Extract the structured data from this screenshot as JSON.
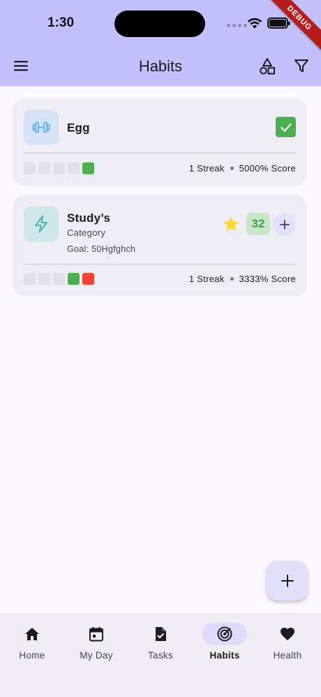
{
  "status_bar": {
    "time": "1:30",
    "debug_label": "DEBUG"
  },
  "app_bar": {
    "title": "Habits"
  },
  "habits": [
    {
      "name": "Egg",
      "icon": "dumbbell-icon",
      "icon_color": "#64b5f6",
      "completed": true,
      "streak_text": "1 Streak",
      "score_text": "5000% Score"
    },
    {
      "name": "Study’s",
      "category": "Category",
      "goal": "Goal: 50Hgfghch",
      "icon": "bolt-icon",
      "icon_color": "#4db6ac",
      "count": "32",
      "streak_text": "1 Streak",
      "score_text": "3333% Score"
    }
  ],
  "fab": {
    "icon": "plus-icon"
  },
  "bottom_nav": {
    "items": [
      {
        "label": "Home",
        "icon": "home-icon"
      },
      {
        "label": "My Day",
        "icon": "calendar-icon"
      },
      {
        "label": "Tasks",
        "icon": "task-file-icon"
      },
      {
        "label": "Habits",
        "icon": "target-icon",
        "active": true
      },
      {
        "label": "Health",
        "icon": "heart-icon"
      }
    ]
  },
  "colors": {
    "app_bar": "#c3c0fb",
    "background": "#fcf8ff",
    "card": "#efedf4",
    "success": "#4caf50",
    "missed": "#f44336",
    "star": "#fdd835"
  }
}
